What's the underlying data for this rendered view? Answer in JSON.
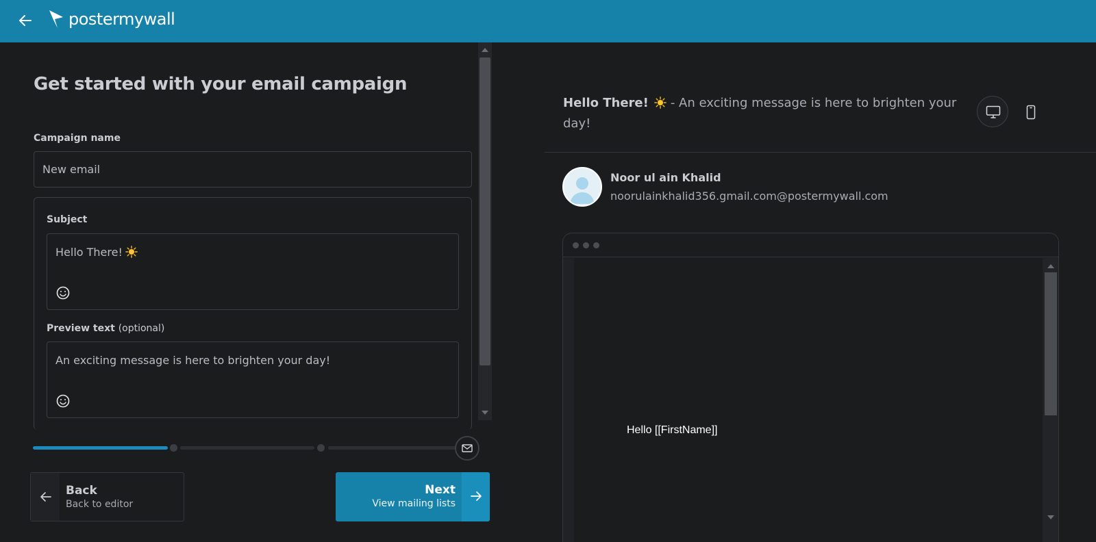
{
  "header": {
    "logo_text": "postermywall",
    "icons": {
      "back": "arrow-left-icon",
      "logo": "postermywall-logo-icon"
    }
  },
  "form": {
    "title": "Get started with your email campaign",
    "campaign_name": {
      "label": "Campaign name",
      "value": "New email"
    },
    "subject": {
      "label": "Subject",
      "value": "Hello There!",
      "emoji": "sun-emoji"
    },
    "preview_text": {
      "label": "Preview text",
      "optional": "(optional)",
      "value": "An exciting message is here to brighten your day!"
    }
  },
  "progress": {
    "current_step": 1,
    "total_steps": 4
  },
  "buttons": {
    "back": {
      "title": "Back",
      "subtitle": "Back to editor"
    },
    "next": {
      "title": "Next",
      "subtitle": "View mailing lists"
    }
  },
  "preview": {
    "subject_bold": "Hello There!",
    "subject_rest": "- An exciting message is here to brighten your day!",
    "sender": {
      "name": "Noor ul ain Khalid",
      "email": "noorulainkhalid356.gmail.com@postermywall.com"
    },
    "body_text": "Hello [[FirstName]]",
    "view_modes": [
      "desktop",
      "mobile"
    ],
    "active_view": "desktop"
  },
  "colors": {
    "brand": "#1682aa",
    "background": "#1b1c1e",
    "progress_fill": "#1a8bbb"
  }
}
